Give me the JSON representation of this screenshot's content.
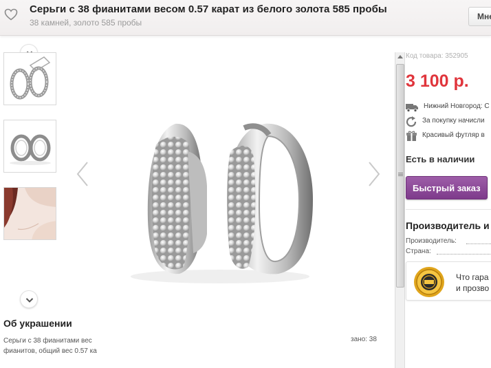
{
  "header": {
    "title": "Серьги с 38 фианитами весом 0.57 карат из белого золота 585 пробы",
    "subtitle": "38 камней, золото 585 пробы",
    "button_label": "Мне"
  },
  "gallery": {
    "prev_icon": "chevron-left-icon",
    "next_icon": "chevron-right-icon"
  },
  "about": {
    "title": "Об украшении",
    "text_line1": "Серьги с 38 фианитами вес",
    "text_line2": "фианитов, общий вес 0.57 ка",
    "text_right": "зано: 38"
  },
  "product": {
    "code": "Код товара: 352905",
    "price": "3 100 р.",
    "delivery": "Нижний Новгород: С",
    "bonus": "За покупку начисли",
    "gift": "Красивый футляр в",
    "stock": "Есть в наличии",
    "quick_order": "Быстрый заказ"
  },
  "maker": {
    "title": "Производитель и",
    "manufacturer_label": "Производитель:",
    "country_label": "Страна:"
  },
  "guarantee": {
    "line1": "Что гара",
    "line2": "и прозво"
  },
  "colors": {
    "price": "#e0353c",
    "button": "#8a4796"
  }
}
